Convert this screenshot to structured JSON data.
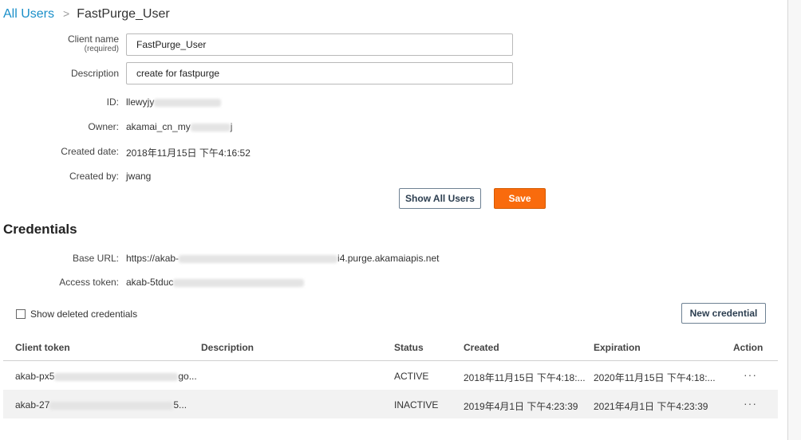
{
  "breadcrumb": {
    "root": "All Users",
    "separator": ">",
    "current": "FastPurge_User"
  },
  "form": {
    "client_name_label": "Client name",
    "client_name_sub": "(required)",
    "client_name_value": "FastPurge_User",
    "description_label": "Description",
    "description_value": "create for fastpurge",
    "id_label": "ID:",
    "id_value": "llewyjy",
    "owner_label": "Owner:",
    "owner_value_start": "akamai_cn_my",
    "owner_value_end": "j",
    "created_date_label": "Created date:",
    "created_date_value": "2018年11月15日 下午4:16:52",
    "created_by_label": "Created by:",
    "created_by_value": "jwang"
  },
  "buttons": {
    "show_all_users": "Show All Users",
    "save": "Save",
    "new_credential": "New credential"
  },
  "credentials": {
    "title": "Credentials",
    "base_url_label": "Base URL:",
    "base_url_start": "https://akab-",
    "base_url_end": "i4.purge.akamaiapis.net",
    "access_token_label": "Access token:",
    "access_token_start": "akab-5tduc",
    "show_deleted_label": "Show deleted credentials",
    "show_deleted_checked": false
  },
  "table": {
    "headers": [
      "Client token",
      "Description",
      "Status",
      "Created",
      "Expiration",
      "Action"
    ],
    "rows": [
      {
        "token_start": "akab-px5",
        "token_end": "go...",
        "description": "",
        "status": "ACTIVE",
        "created": "2018年11月15日 下午4:18:...",
        "expiration": "2020年11月15日 下午4:18:...",
        "action": "···"
      },
      {
        "token_start": "akab-27",
        "token_end": "5...",
        "description": "",
        "status": "INACTIVE",
        "created": "2019年4月1日 下午4:23:39",
        "expiration": "2021年4月1日 下午4:23:39",
        "action": "···"
      }
    ]
  }
}
